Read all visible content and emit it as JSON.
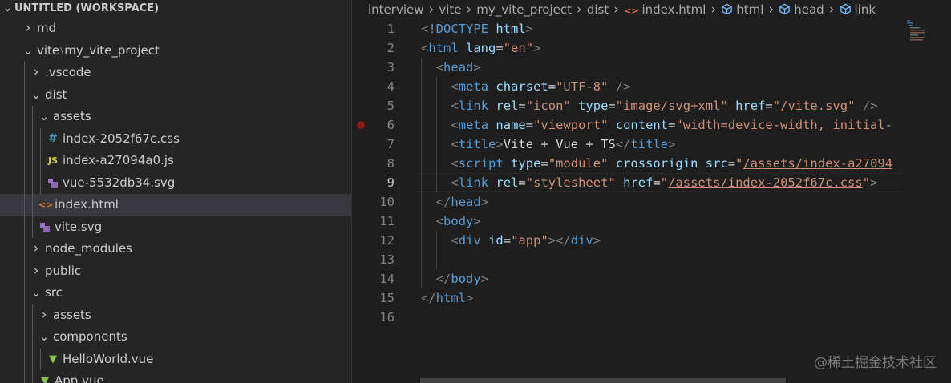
{
  "sidebar": {
    "workspace_title": "UNTITLED (WORKSPACE)",
    "items": [
      {
        "label": "md",
        "type": "folder",
        "open": false,
        "depth": 1
      },
      {
        "label": "vite",
        "label2": "my_vite_project",
        "type": "folder",
        "open": true,
        "depth": 1
      },
      {
        "label": ".vscode",
        "type": "folder",
        "open": false,
        "depth": 2
      },
      {
        "label": "dist",
        "type": "folder",
        "open": true,
        "depth": 2
      },
      {
        "label": "assets",
        "type": "folder",
        "open": true,
        "depth": 3
      },
      {
        "label": "index-2052f67c.css",
        "type": "css",
        "icon": "#",
        "depth": 4
      },
      {
        "label": "index-a27094a0.js",
        "type": "js",
        "icon": "JS",
        "depth": 4
      },
      {
        "label": "vue-5532db34.svg",
        "type": "svg",
        "depth": 4
      },
      {
        "label": "index.html",
        "type": "html",
        "icon": "<>",
        "depth": 3,
        "selected": true
      },
      {
        "label": "vite.svg",
        "type": "svg",
        "depth": 3
      },
      {
        "label": "node_modules",
        "type": "folder",
        "open": false,
        "depth": 2
      },
      {
        "label": "public",
        "type": "folder",
        "open": false,
        "depth": 2
      },
      {
        "label": "src",
        "type": "folder",
        "open": true,
        "depth": 2
      },
      {
        "label": "assets",
        "type": "folder",
        "open": false,
        "depth": 3
      },
      {
        "label": "components",
        "type": "folder",
        "open": true,
        "depth": 3
      },
      {
        "label": "HelloWorld.vue",
        "type": "vue",
        "depth": 4
      },
      {
        "label": "App.vue",
        "type": "vue",
        "depth": 3
      }
    ]
  },
  "breadcrumb": [
    "interview",
    "vite",
    "my_vite_project",
    "dist",
    "index.html",
    "html",
    "head",
    "link"
  ],
  "editor": {
    "current_line": 9,
    "breakpoint_line": 6,
    "lines": [
      {
        "n": "1",
        "indent": 0,
        "tokens": [
          [
            "punc",
            "<"
          ],
          [
            "tag",
            "!DOCTYPE"
          ],
          [
            "txt",
            " "
          ],
          [
            "attr",
            "html"
          ],
          [
            "punc",
            ">"
          ]
        ]
      },
      {
        "n": "2",
        "indent": 0,
        "tokens": [
          [
            "punc",
            "<"
          ],
          [
            "tag",
            "html"
          ],
          [
            "txt",
            " "
          ],
          [
            "attr",
            "lang"
          ],
          [
            "txt",
            "="
          ],
          [
            "str",
            "\"en\""
          ],
          [
            "punc",
            ">"
          ]
        ]
      },
      {
        "n": "3",
        "indent": 1,
        "tokens": [
          [
            "punc",
            "<"
          ],
          [
            "tag",
            "head"
          ],
          [
            "punc",
            ">"
          ]
        ]
      },
      {
        "n": "4",
        "indent": 2,
        "tokens": [
          [
            "punc",
            "<"
          ],
          [
            "tag",
            "meta"
          ],
          [
            "txt",
            " "
          ],
          [
            "attr",
            "charset"
          ],
          [
            "txt",
            "="
          ],
          [
            "str",
            "\"UTF-8\""
          ],
          [
            "txt",
            " "
          ],
          [
            "punc",
            "/>"
          ]
        ]
      },
      {
        "n": "5",
        "indent": 2,
        "tokens": [
          [
            "punc",
            "<"
          ],
          [
            "tag",
            "link"
          ],
          [
            "txt",
            " "
          ],
          [
            "attr",
            "rel"
          ],
          [
            "txt",
            "="
          ],
          [
            "str",
            "\"icon\""
          ],
          [
            "txt",
            " "
          ],
          [
            "attr",
            "type"
          ],
          [
            "txt",
            "="
          ],
          [
            "str",
            "\"image/svg+xml\""
          ],
          [
            "txt",
            " "
          ],
          [
            "attr",
            "href"
          ],
          [
            "txt",
            "="
          ],
          [
            "str",
            "\""
          ],
          [
            "strlink",
            "/vite.svg"
          ],
          [
            "str",
            "\""
          ],
          [
            "txt",
            " "
          ],
          [
            "punc",
            "/>"
          ]
        ]
      },
      {
        "n": "6",
        "indent": 2,
        "tokens": [
          [
            "punc",
            "<"
          ],
          [
            "tag",
            "meta"
          ],
          [
            "txt",
            " "
          ],
          [
            "attr",
            "name"
          ],
          [
            "txt",
            "="
          ],
          [
            "str",
            "\"viewport\""
          ],
          [
            "txt",
            " "
          ],
          [
            "attr",
            "content"
          ],
          [
            "txt",
            "="
          ],
          [
            "str",
            "\"width=device-width, initial-"
          ]
        ]
      },
      {
        "n": "7",
        "indent": 2,
        "tokens": [
          [
            "punc",
            "<"
          ],
          [
            "tag",
            "title"
          ],
          [
            "punc",
            ">"
          ],
          [
            "txt",
            "Vite + Vue + TS"
          ],
          [
            "punc",
            "</"
          ],
          [
            "tag",
            "title"
          ],
          [
            "punc",
            ">"
          ]
        ]
      },
      {
        "n": "8",
        "indent": 2,
        "tokens": [
          [
            "punc",
            "<"
          ],
          [
            "tag",
            "script"
          ],
          [
            "txt",
            " "
          ],
          [
            "attr",
            "type"
          ],
          [
            "txt",
            "="
          ],
          [
            "str",
            "\"module\""
          ],
          [
            "txt",
            " "
          ],
          [
            "attr",
            "crossorigin"
          ],
          [
            "txt",
            " "
          ],
          [
            "attr",
            "src"
          ],
          [
            "txt",
            "="
          ],
          [
            "str",
            "\""
          ],
          [
            "strlink",
            "/assets/index-a27094"
          ]
        ]
      },
      {
        "n": "9",
        "indent": 2,
        "tokens": [
          [
            "punc",
            "<"
          ],
          [
            "tag",
            "link"
          ],
          [
            "txt",
            " "
          ],
          [
            "attr",
            "rel"
          ],
          [
            "txt",
            "="
          ],
          [
            "str",
            "\"stylesheet\""
          ],
          [
            "txt",
            " "
          ],
          [
            "attr",
            "href"
          ],
          [
            "txt",
            "="
          ],
          [
            "str",
            "\""
          ],
          [
            "strlink",
            "/assets/index-2052f67c.css"
          ],
          [
            "str",
            "\""
          ],
          [
            "punc",
            ">"
          ]
        ]
      },
      {
        "n": "10",
        "indent": 1,
        "tokens": [
          [
            "punc",
            "</"
          ],
          [
            "tag",
            "head"
          ],
          [
            "punc",
            ">"
          ]
        ]
      },
      {
        "n": "11",
        "indent": 1,
        "tokens": [
          [
            "punc",
            "<"
          ],
          [
            "tag",
            "body"
          ],
          [
            "punc",
            ">"
          ]
        ]
      },
      {
        "n": "12",
        "indent": 2,
        "tokens": [
          [
            "punc",
            "<"
          ],
          [
            "tag",
            "div"
          ],
          [
            "txt",
            " "
          ],
          [
            "attr",
            "id"
          ],
          [
            "txt",
            "="
          ],
          [
            "str",
            "\"app\""
          ],
          [
            "punc",
            "></"
          ],
          [
            "tag",
            "div"
          ],
          [
            "punc",
            ">"
          ]
        ]
      },
      {
        "n": "13",
        "indent": 2,
        "tokens": []
      },
      {
        "n": "14",
        "indent": 1,
        "tokens": [
          [
            "punc",
            "</"
          ],
          [
            "tag",
            "body"
          ],
          [
            "punc",
            ">"
          ]
        ]
      },
      {
        "n": "15",
        "indent": 0,
        "tokens": [
          [
            "punc",
            "</"
          ],
          [
            "tag",
            "html"
          ],
          [
            "punc",
            ">"
          ]
        ]
      },
      {
        "n": "16",
        "indent": 0,
        "tokens": []
      }
    ]
  },
  "watermark": "@稀土掘金技术社区",
  "colors": {
    "tag": "#569cd6",
    "attr": "#9cdcfe",
    "string": "#ce9178",
    "punctuation": "#808080",
    "background": "#1e1e1e",
    "sidebar": "#252526",
    "selected": "#37373d"
  }
}
